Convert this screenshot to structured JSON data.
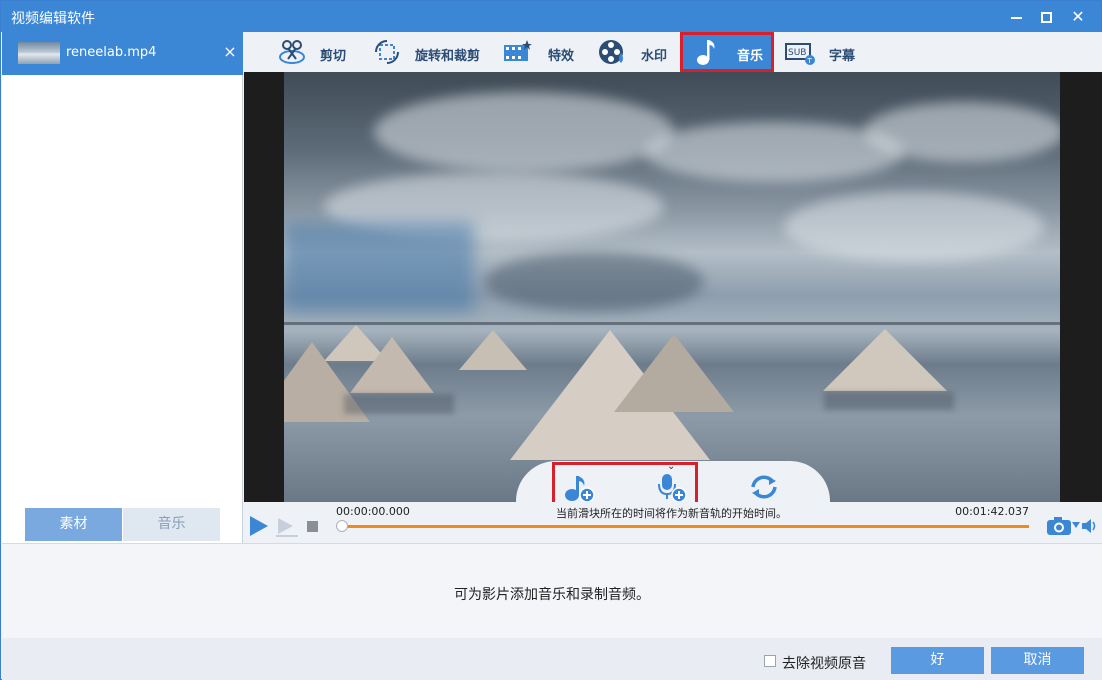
{
  "window": {
    "title": "视频编辑软件"
  },
  "file_tab": {
    "filename": "reneelab.mp4",
    "close": "×"
  },
  "left_tabs": {
    "material": "素材",
    "music": "音乐"
  },
  "toolbar": [
    {
      "id": "cut",
      "label": "剪切",
      "icon": "scissors-icon"
    },
    {
      "id": "rotate",
      "label": "旋转和裁剪",
      "icon": "crop-rotate-icon"
    },
    {
      "id": "effects",
      "label": "特效",
      "icon": "film-effects-icon"
    },
    {
      "id": "watermark",
      "label": "水印",
      "icon": "watermark-icon"
    },
    {
      "id": "music",
      "label": "音乐",
      "icon": "music-note-icon",
      "active": true
    },
    {
      "id": "subtitle",
      "label": "字幕",
      "icon": "subtitle-icon"
    }
  ],
  "timeline": {
    "start_time": "00:00:00.000",
    "end_time": "00:01:42.037",
    "note": "当前滑块所在的时间将作为新音轨的开始时间。"
  },
  "info": {
    "text": "可为影片添加音乐和录制音频。"
  },
  "footer": {
    "remove_audio_label": "去除视频原音",
    "ok_label": "好",
    "cancel_label": "取消"
  },
  "colors": {
    "accent": "#3b87d6",
    "highlight": "#d9202a",
    "progress": "#f08a1c"
  }
}
